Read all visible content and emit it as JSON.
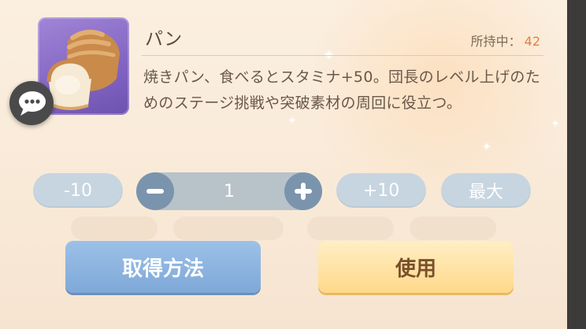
{
  "item": {
    "name": "パン",
    "owned_label": "所持中：",
    "owned_count": "42",
    "description": "焼きパン、食べるとスタミナ+50。団長のレベル上げのためのステージ挑戦や突破素材の周回に役立つ。",
    "icon": "bread-loaf-icon"
  },
  "quantity": {
    "minus10_label": "-10",
    "value": "1",
    "plus10_label": "+10",
    "max_label": "最大",
    "minus_icon": "minus-icon",
    "plus_icon": "plus-icon"
  },
  "actions": {
    "obtain_label": "取得方法",
    "use_label": "使用"
  },
  "chat": {
    "icon": "chat-bubble-icon"
  },
  "colors": {
    "panel_bg": "#fbefe0",
    "item_frame": "#8467c4",
    "owned_count": "#e0823f",
    "stepper_button": "#7b94ad",
    "obtain_button": "#8ab2df",
    "use_button": "#ffe2a0"
  }
}
